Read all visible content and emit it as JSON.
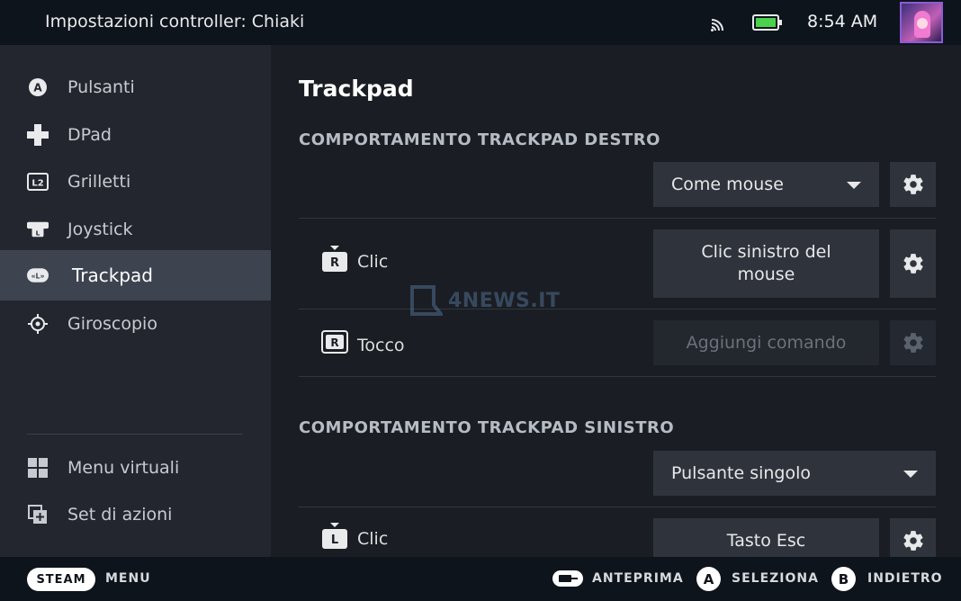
{
  "topbar": {
    "title": "Impostazioni controller: Chiaki",
    "time": "8:54 AM"
  },
  "sidebar": {
    "items": [
      {
        "label": "Pulsanti",
        "icon": "a-button-icon"
      },
      {
        "label": "DPad",
        "icon": "dpad-icon"
      },
      {
        "label": "Grilletti",
        "icon": "l2-trigger-icon"
      },
      {
        "label": "Joystick",
        "icon": "joystick-icon"
      },
      {
        "label": "Trackpad",
        "icon": "trackpad-icon",
        "active": true
      },
      {
        "label": "Giroscopio",
        "icon": "gyro-icon"
      }
    ],
    "bottom_items": [
      {
        "label": "Menu virtuali",
        "icon": "grid-icon"
      },
      {
        "label": "Set di azioni",
        "icon": "action-set-icon"
      }
    ]
  },
  "main": {
    "title": "Trackpad",
    "right_section": {
      "title": "COMPORTAMENTO TRACKPAD DESTRO",
      "mode": "Come mouse",
      "rows": [
        {
          "label": "Clic",
          "command": "Clic sinistro del mouse",
          "glyph": "R"
        },
        {
          "label": "Tocco",
          "command": "Aggiungi comando",
          "glyph": "R",
          "empty": true
        }
      ]
    },
    "left_section": {
      "title": "COMPORTAMENTO TRACKPAD SINISTRO",
      "mode": "Pulsante singolo",
      "rows": [
        {
          "label": "Clic",
          "command": "Tasto Esc",
          "glyph": "L"
        }
      ]
    },
    "watermark": "4NEWS.IT"
  },
  "bottombar": {
    "steam": "STEAM",
    "menu": "MENU",
    "preview": "ANTEPRIMA",
    "select_key": "A",
    "select": "SELEZIONA",
    "back_key": "B",
    "back": "INDIETRO"
  },
  "colors": {
    "accent_active": "#3d4450",
    "avatar_border": "#8b5cd6",
    "battery": "#4cd14c"
  }
}
